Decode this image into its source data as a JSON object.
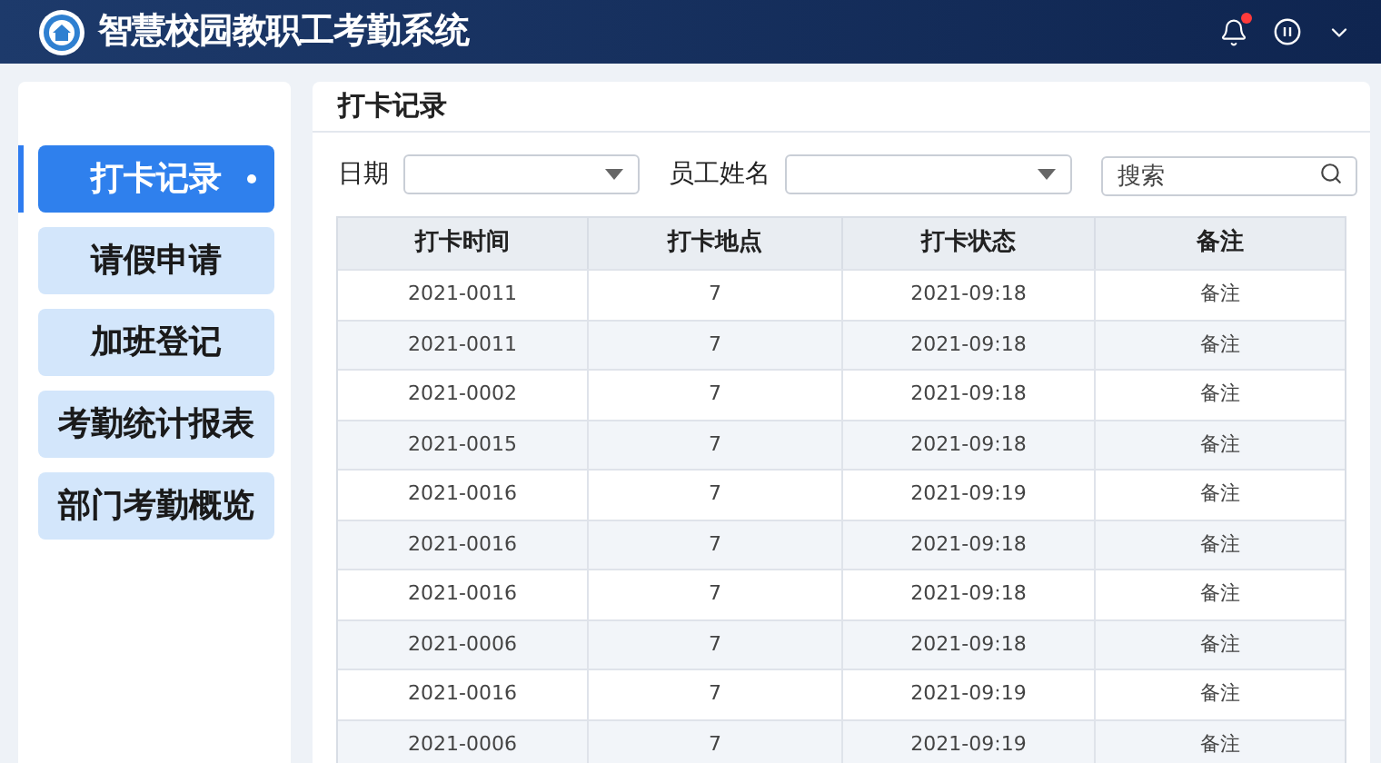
{
  "header": {
    "title": "智慧校园教职工考勤系统",
    "notification_unread": true
  },
  "sidebar": {
    "items": [
      {
        "label": "打卡记录",
        "selected": true
      },
      {
        "label": "请假申请",
        "selected": false
      },
      {
        "label": "加班登记",
        "selected": false
      },
      {
        "label": "考勤统计报表",
        "selected": false
      },
      {
        "label": "部门考勤概览",
        "selected": false
      }
    ]
  },
  "panel": {
    "title": "打卡记录"
  },
  "filters": [
    {
      "kind": "select",
      "label": "日期"
    },
    {
      "kind": "select",
      "label": "员工姓名"
    },
    {
      "kind": "search",
      "placeholder": "搜索"
    }
  ],
  "table": {
    "columns": [
      "打卡时间",
      "打卡地点",
      "打卡状态",
      "备注"
    ],
    "rows": [
      [
        "2021-0011",
        "7",
        "2021-09:18",
        "备注"
      ],
      [
        "2021-0011",
        "7",
        "2021-09:18",
        "备注"
      ],
      [
        "2021-0002",
        "7",
        "2021-09:18",
        "备注"
      ],
      [
        "2021-0015",
        "7",
        "2021-09:18",
        "备注"
      ],
      [
        "2021-0016",
        "7",
        "2021-09:19",
        "备注"
      ],
      [
        "2021-0016",
        "7",
        "2021-09:18",
        "备注"
      ],
      [
        "2021-0016",
        "7",
        "2021-09:18",
        "备注"
      ],
      [
        "2021-0006",
        "7",
        "2021-09:18",
        "备注"
      ],
      [
        "2021-0016",
        "7",
        "2021-09:19",
        "备注"
      ],
      [
        "2021-0006",
        "7",
        "2021-09:19",
        "备注"
      ]
    ]
  }
}
